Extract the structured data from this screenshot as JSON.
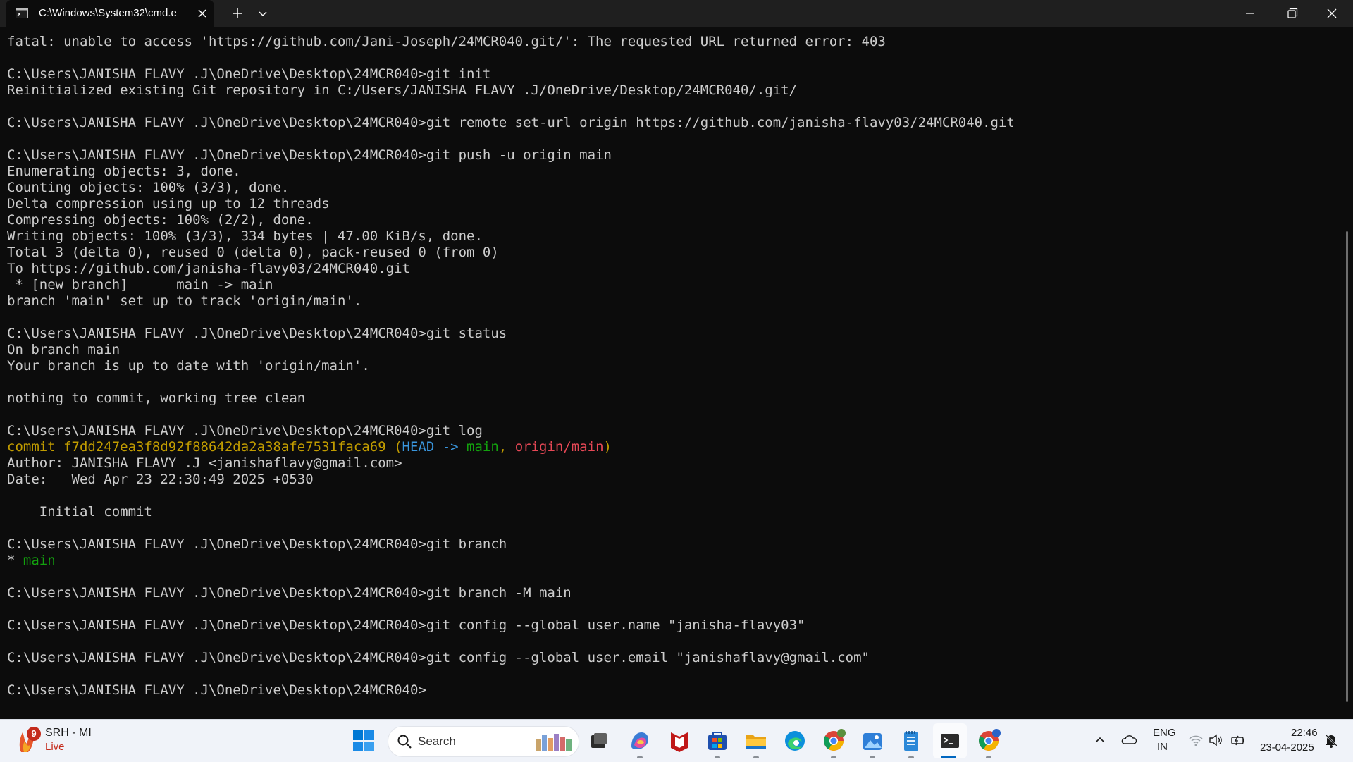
{
  "tab": {
    "title": "C:\\Windows\\System32\\cmd.e"
  },
  "terminal": {
    "lines": [
      [
        {
          "t": "fatal: unable to access 'https://github.com/Jani-Joseph/24MCR040.git/': The requested URL returned error: 403"
        }
      ],
      [
        {
          "t": ""
        }
      ],
      [
        {
          "t": "C:\\Users\\JANISHA FLAVY .J\\OneDrive\\Desktop\\24MCR040>git init"
        }
      ],
      [
        {
          "t": "Reinitialized existing Git repository in C:/Users/JANISHA FLAVY .J/OneDrive/Desktop/24MCR040/.git/"
        }
      ],
      [
        {
          "t": ""
        }
      ],
      [
        {
          "t": "C:\\Users\\JANISHA FLAVY .J\\OneDrive\\Desktop\\24MCR040>git remote set-url origin https://github.com/janisha-flavy03/24MCR040.git"
        }
      ],
      [
        {
          "t": ""
        }
      ],
      [
        {
          "t": "C:\\Users\\JANISHA FLAVY .J\\OneDrive\\Desktop\\24MCR040>git push -u origin main"
        }
      ],
      [
        {
          "t": "Enumerating objects: 3, done."
        }
      ],
      [
        {
          "t": "Counting objects: 100% (3/3), done."
        }
      ],
      [
        {
          "t": "Delta compression using up to 12 threads"
        }
      ],
      [
        {
          "t": "Compressing objects: 100% (2/2), done."
        }
      ],
      [
        {
          "t": "Writing objects: 100% (3/3), 334 bytes | 47.00 KiB/s, done."
        }
      ],
      [
        {
          "t": "Total 3 (delta 0), reused 0 (delta 0), pack-reused 0 (from 0)"
        }
      ],
      [
        {
          "t": "To https://github.com/janisha-flavy03/24MCR040.git"
        }
      ],
      [
        {
          "t": " * [new branch]      main -> main"
        }
      ],
      [
        {
          "t": "branch 'main' set up to track 'origin/main'."
        }
      ],
      [
        {
          "t": ""
        }
      ],
      [
        {
          "t": "C:\\Users\\JANISHA FLAVY .J\\OneDrive\\Desktop\\24MCR040>git status"
        }
      ],
      [
        {
          "t": "On branch main"
        }
      ],
      [
        {
          "t": "Your branch is up to date with 'origin/main'."
        }
      ],
      [
        {
          "t": ""
        }
      ],
      [
        {
          "t": "nothing to commit, working tree clean"
        }
      ],
      [
        {
          "t": ""
        }
      ],
      [
        {
          "t": "C:\\Users\\JANISHA FLAVY .J\\OneDrive\\Desktop\\24MCR040>git log"
        }
      ],
      [
        {
          "t": "commit f7dd247ea3f8d92f88642da2a38afe7531faca69 (",
          "c": "y"
        },
        {
          "t": "HEAD -> ",
          "c": "c"
        },
        {
          "t": "main",
          "c": "g"
        },
        {
          "t": ", ",
          "c": "y"
        },
        {
          "t": "origin/main",
          "c": "r"
        },
        {
          "t": ")",
          "c": "y"
        }
      ],
      [
        {
          "t": "Author: JANISHA FLAVY .J <janishaflavy@gmail.com>"
        }
      ],
      [
        {
          "t": "Date:   Wed Apr 23 22:30:49 2025 +0530"
        }
      ],
      [
        {
          "t": ""
        }
      ],
      [
        {
          "t": "    Initial commit"
        }
      ],
      [
        {
          "t": ""
        }
      ],
      [
        {
          "t": "C:\\Users\\JANISHA FLAVY .J\\OneDrive\\Desktop\\24MCR040>git branch"
        }
      ],
      [
        {
          "t": "* "
        },
        {
          "t": "main",
          "c": "g"
        }
      ],
      [
        {
          "t": ""
        }
      ],
      [
        {
          "t": "C:\\Users\\JANISHA FLAVY .J\\OneDrive\\Desktop\\24MCR040>git branch -M main"
        }
      ],
      [
        {
          "t": ""
        }
      ],
      [
        {
          "t": "C:\\Users\\JANISHA FLAVY .J\\OneDrive\\Desktop\\24MCR040>git config --global user.name \"janisha-flavy03\""
        }
      ],
      [
        {
          "t": ""
        }
      ],
      [
        {
          "t": "C:\\Users\\JANISHA FLAVY .J\\OneDrive\\Desktop\\24MCR040>git config --global user.email \"janishaflavy@gmail.com\""
        }
      ],
      [
        {
          "t": ""
        }
      ],
      [
        {
          "t": "C:\\Users\\JANISHA FLAVY .J\\OneDrive\\Desktop\\24MCR040>"
        }
      ]
    ]
  },
  "taskbar": {
    "widget": {
      "badge": "9",
      "title": "SRH - MI",
      "status": "Live"
    },
    "search_label": "Search",
    "tray": {
      "lang_line1": "ENG",
      "lang_line2": "IN",
      "time": "22:46",
      "date": "23-04-2025"
    },
    "accent": "#0067c0"
  }
}
